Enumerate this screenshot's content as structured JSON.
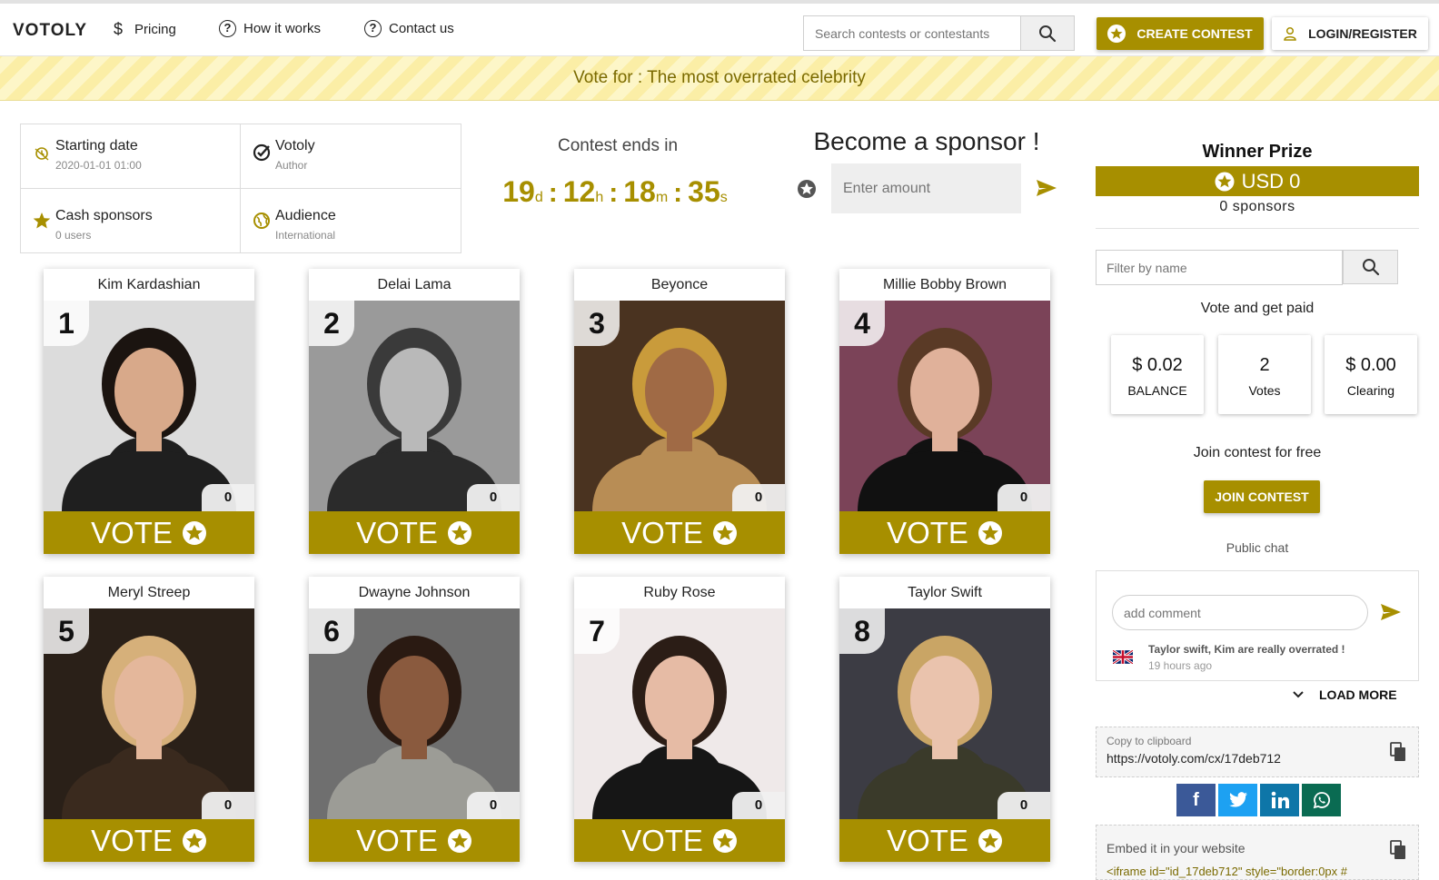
{
  "brand": {
    "logo": "VOTOLY",
    "accent": "#a78f00"
  },
  "nav": {
    "pricing": "Pricing",
    "how_it_works": "How it works",
    "contact": "Contact us"
  },
  "search": {
    "placeholder": "Search contests or contestants"
  },
  "actions": {
    "create_contest": "CREATE CONTEST",
    "login": "LOGIN/REGISTER"
  },
  "banner": "Vote for : The most overrated celebrity",
  "info": {
    "starting_date_label": "Starting date",
    "starting_date_value": "2020-01-01 01:00",
    "author_label": "Votoly",
    "author_sub": "Author",
    "cash_label": "Cash sponsors",
    "cash_sub": "0 users",
    "audience_label": "Audience",
    "audience_sub": "International"
  },
  "countdown": {
    "label": "Contest ends in",
    "days": "19",
    "days_unit": "d",
    "hours": "12",
    "hours_unit": "h",
    "minutes": "18",
    "minutes_unit": "m",
    "seconds": "35",
    "seconds_unit": "s"
  },
  "sponsor": {
    "title": "Become a sponsor !",
    "placeholder": "Enter amount"
  },
  "contestants": [
    {
      "rank": "1",
      "name": "Kim Kardashian",
      "votes": "0",
      "vote_label": "VOTE"
    },
    {
      "rank": "2",
      "name": "Delai Lama",
      "votes": "0",
      "vote_label": "VOTE"
    },
    {
      "rank": "3",
      "name": "Beyonce",
      "votes": "0",
      "vote_label": "VOTE"
    },
    {
      "rank": "4",
      "name": "Millie Bobby Brown",
      "votes": "0",
      "vote_label": "VOTE"
    },
    {
      "rank": "5",
      "name": "Meryl Streep",
      "votes": "0",
      "vote_label": "VOTE"
    },
    {
      "rank": "6",
      "name": "Dwayne Johnson",
      "votes": "0",
      "vote_label": "VOTE"
    },
    {
      "rank": "7",
      "name": "Ruby Rose",
      "votes": "0",
      "vote_label": "VOTE"
    },
    {
      "rank": "8",
      "name": "Taylor Swift",
      "votes": "0",
      "vote_label": "VOTE"
    }
  ],
  "prize": {
    "title": "Winner Prize",
    "amount": "USD 0",
    "sponsors": "0 sponsors"
  },
  "filter": {
    "placeholder": "Filter by name"
  },
  "earnings": {
    "title": "Vote and get paid",
    "balance_value": "$ 0.02",
    "balance_label": "BALANCE",
    "votes_value": "2",
    "votes_label": "Votes",
    "clearing_value": "$ 0.00",
    "clearing_label": "Clearing"
  },
  "join": {
    "label": "Join contest for free",
    "button": "JOIN CONTEST"
  },
  "chat": {
    "title": "Public chat",
    "placeholder": "add comment",
    "message": "Taylor swift, Kim are really overrated !",
    "time": "19 hours ago",
    "load_more": "LOAD MORE"
  },
  "share": {
    "copy_label": "Copy to clipboard",
    "url": "https://votoly.com/cx/17deb712",
    "facebook": "f",
    "embed_label": "Embed it in your website",
    "embed_code": "<iframe id=\"id_17deb712\" style=\"border:0px #"
  }
}
